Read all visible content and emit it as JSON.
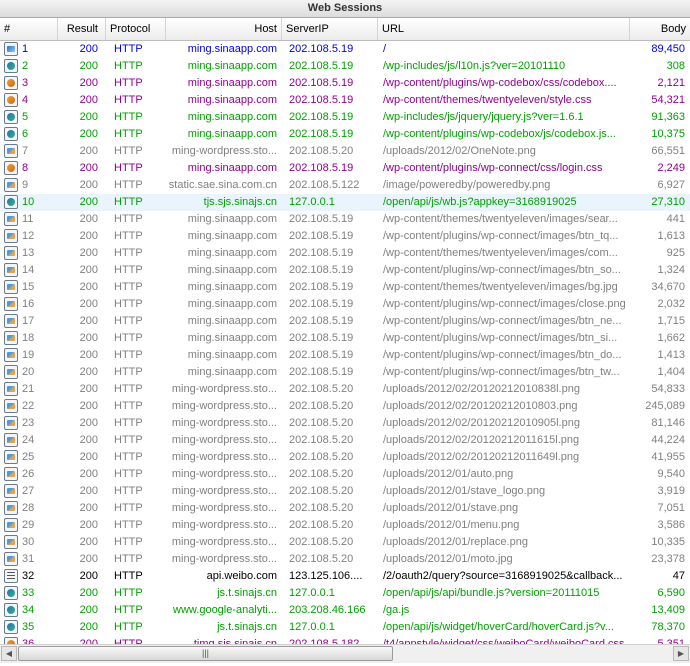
{
  "window": {
    "title": "Web Sessions"
  },
  "columns": {
    "num": "#",
    "result": "Result",
    "protocol": "Protocol",
    "host": "Host",
    "serverip": "ServerIP",
    "url": "URL",
    "body": "Body"
  },
  "colors": {
    "blue": "#0000e0",
    "green": "#00a000",
    "purple": "#900090",
    "gray": "#808080",
    "black": "#000000",
    "selected_row": "#eaf4fd"
  },
  "scrollbar": {
    "thumb_grip": "|||",
    "left_arrow": "◀",
    "right_arrow": "▶"
  },
  "sessions": [
    {
      "num": "1",
      "result": "200",
      "protocol": "HTTP",
      "host": "ming.sinaapp.com",
      "serverip": "202.108.5.19",
      "url": "/",
      "body": "89,450",
      "color": "blue",
      "icon": "html-icon"
    },
    {
      "num": "2",
      "result": "200",
      "protocol": "HTTP",
      "host": "ming.sinaapp.com",
      "serverip": "202.108.5.19",
      "url": "/wp-includes/js/l10n.js?ver=20101110",
      "body": "308",
      "color": "green",
      "icon": "js-icon"
    },
    {
      "num": "3",
      "result": "200",
      "protocol": "HTTP",
      "host": "ming.sinaapp.com",
      "serverip": "202.108.5.19",
      "url": "/wp-content/plugins/wp-codebox/css/codebox....",
      "body": "2,121",
      "color": "purple",
      "icon": "css-icon"
    },
    {
      "num": "4",
      "result": "200",
      "protocol": "HTTP",
      "host": "ming.sinaapp.com",
      "serverip": "202.108.5.19",
      "url": "/wp-content/themes/twentyeleven/style.css",
      "body": "54,321",
      "color": "purple",
      "icon": "css-icon"
    },
    {
      "num": "5",
      "result": "200",
      "protocol": "HTTP",
      "host": "ming.sinaapp.com",
      "serverip": "202.108.5.19",
      "url": "/wp-includes/js/jquery/jquery.js?ver=1.6.1",
      "body": "91,363",
      "color": "green",
      "icon": "js-icon"
    },
    {
      "num": "6",
      "result": "200",
      "protocol": "HTTP",
      "host": "ming.sinaapp.com",
      "serverip": "202.108.5.19",
      "url": "/wp-content/plugins/wp-codebox/js/codebox.js...",
      "body": "10,375",
      "color": "green",
      "icon": "js-icon"
    },
    {
      "num": "7",
      "result": "200",
      "protocol": "HTTP",
      "host": "ming-wordpress.sto...",
      "serverip": "202.108.5.20",
      "url": "/uploads/2012/02/OneNote.png",
      "body": "66,551",
      "color": "gray",
      "icon": "image-icon"
    },
    {
      "num": "8",
      "result": "200",
      "protocol": "HTTP",
      "host": "ming.sinaapp.com",
      "serverip": "202.108.5.19",
      "url": "/wp-content/plugins/wp-connect/css/login.css",
      "body": "2,249",
      "color": "purple",
      "icon": "css-icon"
    },
    {
      "num": "9",
      "result": "200",
      "protocol": "HTTP",
      "host": "static.sae.sina.com.cn",
      "serverip": "202.108.5.122",
      "url": "/image/poweredby/poweredby.png",
      "body": "6,927",
      "color": "gray",
      "icon": "image-icon"
    },
    {
      "num": "10",
      "result": "200",
      "protocol": "HTTP",
      "host": "tjs.sjs.sinajs.cn",
      "serverip": "127.0.0.1",
      "url": "/open/api/js/wb.js?appkey=3168919025",
      "body": "27,310",
      "color": "green",
      "icon": "js-icon",
      "selected": true
    },
    {
      "num": "11",
      "result": "200",
      "protocol": "HTTP",
      "host": "ming.sinaapp.com",
      "serverip": "202.108.5.19",
      "url": "/wp-content/themes/twentyeleven/images/sear...",
      "body": "441",
      "color": "gray",
      "icon": "image-icon"
    },
    {
      "num": "12",
      "result": "200",
      "protocol": "HTTP",
      "host": "ming.sinaapp.com",
      "serverip": "202.108.5.19",
      "url": "/wp-content/plugins/wp-connect/images/btn_tq...",
      "body": "1,613",
      "color": "gray",
      "icon": "image-icon"
    },
    {
      "num": "13",
      "result": "200",
      "protocol": "HTTP",
      "host": "ming.sinaapp.com",
      "serverip": "202.108.5.19",
      "url": "/wp-content/themes/twentyeleven/images/com...",
      "body": "925",
      "color": "gray",
      "icon": "image-icon"
    },
    {
      "num": "14",
      "result": "200",
      "protocol": "HTTP",
      "host": "ming.sinaapp.com",
      "serverip": "202.108.5.19",
      "url": "/wp-content/plugins/wp-connect/images/btn_so...",
      "body": "1,324",
      "color": "gray",
      "icon": "image-icon"
    },
    {
      "num": "15",
      "result": "200",
      "protocol": "HTTP",
      "host": "ming.sinaapp.com",
      "serverip": "202.108.5.19",
      "url": "/wp-content/themes/twentyeleven/images/bg.jpg",
      "body": "34,670",
      "color": "gray",
      "icon": "image-icon"
    },
    {
      "num": "16",
      "result": "200",
      "protocol": "HTTP",
      "host": "ming.sinaapp.com",
      "serverip": "202.108.5.19",
      "url": "/wp-content/plugins/wp-connect/images/close.png",
      "body": "2,032",
      "color": "gray",
      "icon": "image-icon"
    },
    {
      "num": "17",
      "result": "200",
      "protocol": "HTTP",
      "host": "ming.sinaapp.com",
      "serverip": "202.108.5.19",
      "url": "/wp-content/plugins/wp-connect/images/btn_ne...",
      "body": "1,715",
      "color": "gray",
      "icon": "image-icon"
    },
    {
      "num": "18",
      "result": "200",
      "protocol": "HTTP",
      "host": "ming.sinaapp.com",
      "serverip": "202.108.5.19",
      "url": "/wp-content/plugins/wp-connect/images/btn_si...",
      "body": "1,662",
      "color": "gray",
      "icon": "image-icon"
    },
    {
      "num": "19",
      "result": "200",
      "protocol": "HTTP",
      "host": "ming.sinaapp.com",
      "serverip": "202.108.5.19",
      "url": "/wp-content/plugins/wp-connect/images/btn_do...",
      "body": "1,413",
      "color": "gray",
      "icon": "image-icon"
    },
    {
      "num": "20",
      "result": "200",
      "protocol": "HTTP",
      "host": "ming.sinaapp.com",
      "serverip": "202.108.5.19",
      "url": "/wp-content/plugins/wp-connect/images/btn_tw...",
      "body": "1,404",
      "color": "gray",
      "icon": "image-icon"
    },
    {
      "num": "21",
      "result": "200",
      "protocol": "HTTP",
      "host": "ming-wordpress.sto...",
      "serverip": "202.108.5.20",
      "url": "/uploads/2012/02/20120212010838l.png",
      "body": "54,833",
      "color": "gray",
      "icon": "image-icon"
    },
    {
      "num": "22",
      "result": "200",
      "protocol": "HTTP",
      "host": "ming-wordpress.sto...",
      "serverip": "202.108.5.20",
      "url": "/uploads/2012/02/20120212010803.png",
      "body": "245,089",
      "color": "gray",
      "icon": "image-icon"
    },
    {
      "num": "23",
      "result": "200",
      "protocol": "HTTP",
      "host": "ming-wordpress.sto...",
      "serverip": "202.108.5.20",
      "url": "/uploads/2012/02/20120212010905l.png",
      "body": "81,146",
      "color": "gray",
      "icon": "image-icon"
    },
    {
      "num": "24",
      "result": "200",
      "protocol": "HTTP",
      "host": "ming-wordpress.sto...",
      "serverip": "202.108.5.20",
      "url": "/uploads/2012/02/20120212011615l.png",
      "body": "44,224",
      "color": "gray",
      "icon": "image-icon"
    },
    {
      "num": "25",
      "result": "200",
      "protocol": "HTTP",
      "host": "ming-wordpress.sto...",
      "serverip": "202.108.5.20",
      "url": "/uploads/2012/02/20120212011649l.png",
      "body": "41,955",
      "color": "gray",
      "icon": "image-icon"
    },
    {
      "num": "26",
      "result": "200",
      "protocol": "HTTP",
      "host": "ming-wordpress.sto...",
      "serverip": "202.108.5.20",
      "url": "/uploads/2012/01/auto.png",
      "body": "9,540",
      "color": "gray",
      "icon": "image-icon"
    },
    {
      "num": "27",
      "result": "200",
      "protocol": "HTTP",
      "host": "ming-wordpress.sto...",
      "serverip": "202.108.5.20",
      "url": "/uploads/2012/01/stave_logo.png",
      "body": "3,919",
      "color": "gray",
      "icon": "image-icon"
    },
    {
      "num": "28",
      "result": "200",
      "protocol": "HTTP",
      "host": "ming-wordpress.sto...",
      "serverip": "202.108.5.20",
      "url": "/uploads/2012/01/stave.png",
      "body": "7,051",
      "color": "gray",
      "icon": "image-icon"
    },
    {
      "num": "29",
      "result": "200",
      "protocol": "HTTP",
      "host": "ming-wordpress.sto...",
      "serverip": "202.108.5.20",
      "url": "/uploads/2012/01/menu.png",
      "body": "3,586",
      "color": "gray",
      "icon": "image-icon"
    },
    {
      "num": "30",
      "result": "200",
      "protocol": "HTTP",
      "host": "ming-wordpress.sto...",
      "serverip": "202.108.5.20",
      "url": "/uploads/2012/01/replace.png",
      "body": "10,335",
      "color": "gray",
      "icon": "image-icon"
    },
    {
      "num": "31",
      "result": "200",
      "protocol": "HTTP",
      "host": "ming-wordpress.sto...",
      "serverip": "202.108.5.20",
      "url": "/uploads/2012/01/moto.jpg",
      "body": "23,378",
      "color": "gray",
      "icon": "image-icon"
    },
    {
      "num": "32",
      "result": "200",
      "protocol": "HTTP",
      "host": "api.weibo.com",
      "serverip": "123.125.106....",
      "url": "/2/oauth2/query?source=3168919025&callback...",
      "body": "47",
      "color": "black",
      "icon": "document-icon"
    },
    {
      "num": "33",
      "result": "200",
      "protocol": "HTTP",
      "host": "js.t.sinajs.cn",
      "serverip": "127.0.0.1",
      "url": "/open/api/js/api/bundle.js?version=20111015",
      "body": "6,590",
      "color": "green",
      "icon": "js-icon"
    },
    {
      "num": "34",
      "result": "200",
      "protocol": "HTTP",
      "host": "www.google-analyti...",
      "serverip": "203.208.46.166",
      "url": "/ga.js",
      "body": "13,409",
      "color": "green",
      "icon": "js-icon"
    },
    {
      "num": "35",
      "result": "200",
      "protocol": "HTTP",
      "host": "js.t.sinajs.cn",
      "serverip": "127.0.0.1",
      "url": "/open/api/js/widget/hoverCard/hoverCard.js?v...",
      "body": "78,370",
      "color": "green",
      "icon": "js-icon"
    },
    {
      "num": "36",
      "result": "200",
      "protocol": "HTTP",
      "host": "timg.sjs.sinajs.cn",
      "serverip": "202.108.5.182",
      "url": "/t4/appstyle/widget/css/weiboCard/weiboCard.css",
      "body": "5,351",
      "color": "purple",
      "icon": "css-icon"
    }
  ]
}
